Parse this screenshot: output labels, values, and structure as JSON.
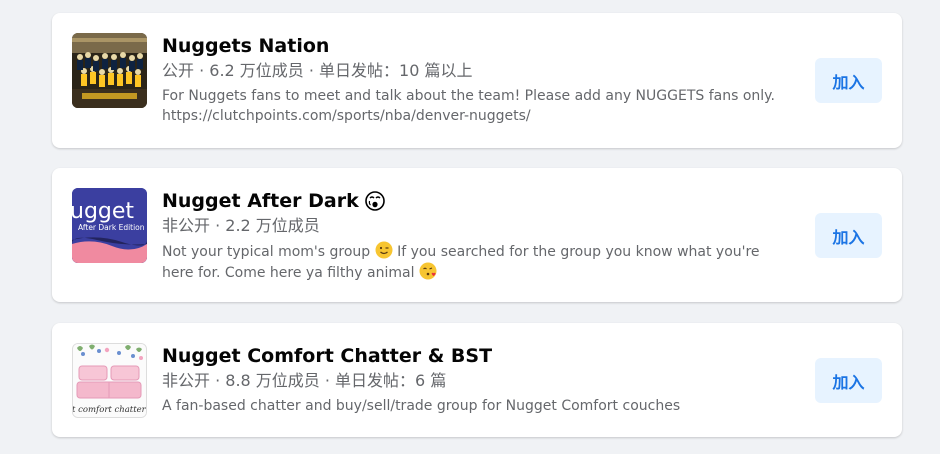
{
  "groups": [
    {
      "name": "Nuggets Nation",
      "meta": "公开 · 6.2 万位成员 · 单日发帖：10 篇以上",
      "desc_line1": "For Nuggets fans to meet and talk about the team! Please add any NUGGETS fans only.",
      "desc_line2": "https://clutchpoints.com/sports/nba/denver-nuggets/",
      "join_label": "加入",
      "thumbnail_icon": "team-photo-icon"
    },
    {
      "name": "Nugget After Dark",
      "title_emoji": "face-holding-back-tears-icon",
      "meta": "非公开 · 2.2 万位成员",
      "desc_part1": "Not your typical mom's group",
      "desc_emoji1": "winking-face-icon",
      "desc_part2": "If you searched for the group you know what you're",
      "desc_part3": "here for. Come here ya filthy animal",
      "desc_emoji2": "face-blowing-kiss-icon",
      "join_label": "加入",
      "thumb_text_big": "ugget",
      "thumb_text_small": "After Dark Edition",
      "thumbnail_icon": "nugget-after-dark-logo-icon"
    },
    {
      "name": "Nugget Comfort Chatter & BST",
      "meta": "非公开 · 8.8 万位成员 · 单日发帖：6 篇",
      "desc_line1": "A fan-based chatter and buy/sell/trade group for Nugget Comfort couches",
      "join_label": "加入",
      "thumb_text": "t comfort chatter",
      "thumbnail_icon": "pink-couch-icon"
    }
  ],
  "colors": {
    "page_bg": "#f0f2f5",
    "button_bg": "#e7f3ff",
    "button_text": "#1b74e4",
    "secondary_text": "#65676b"
  }
}
